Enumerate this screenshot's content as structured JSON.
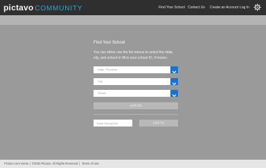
{
  "header": {
    "brand": "pictavo",
    "brand_suffix": "COMMUNITY",
    "nav": [
      {
        "label": "Find Your School"
      },
      {
        "label": "Contact Us"
      },
      {
        "label": "Create an Account"
      },
      {
        "label": "Log In"
      }
    ],
    "settings_icon": "gear-icon"
  },
  "form": {
    "heading": "Find Your School",
    "instructions": "You can either use the list menus to select the state, city, and school or fill in your school ID, if known.",
    "state_placeholder": "State / Province",
    "city_placeholder": "City",
    "school_placeholder": "School",
    "lets_go_label": "Let's Go",
    "school_id_placeholder": "Enter School ID#",
    "lets_go_id_label": "Let's Go"
  },
  "footer": {
    "home_link": "Pictavo.com Home",
    "sep1": "|",
    "copyright": "©2020 Pictavo. All Rights Reserved",
    "sep2": "|",
    "terms_link": "Terms of Use"
  },
  "colors": {
    "header_bg": "#2f2f2f",
    "page_bg": "#9a9a9a",
    "accent": "#1d72c6",
    "brand_accent": "#3aa2cc"
  }
}
